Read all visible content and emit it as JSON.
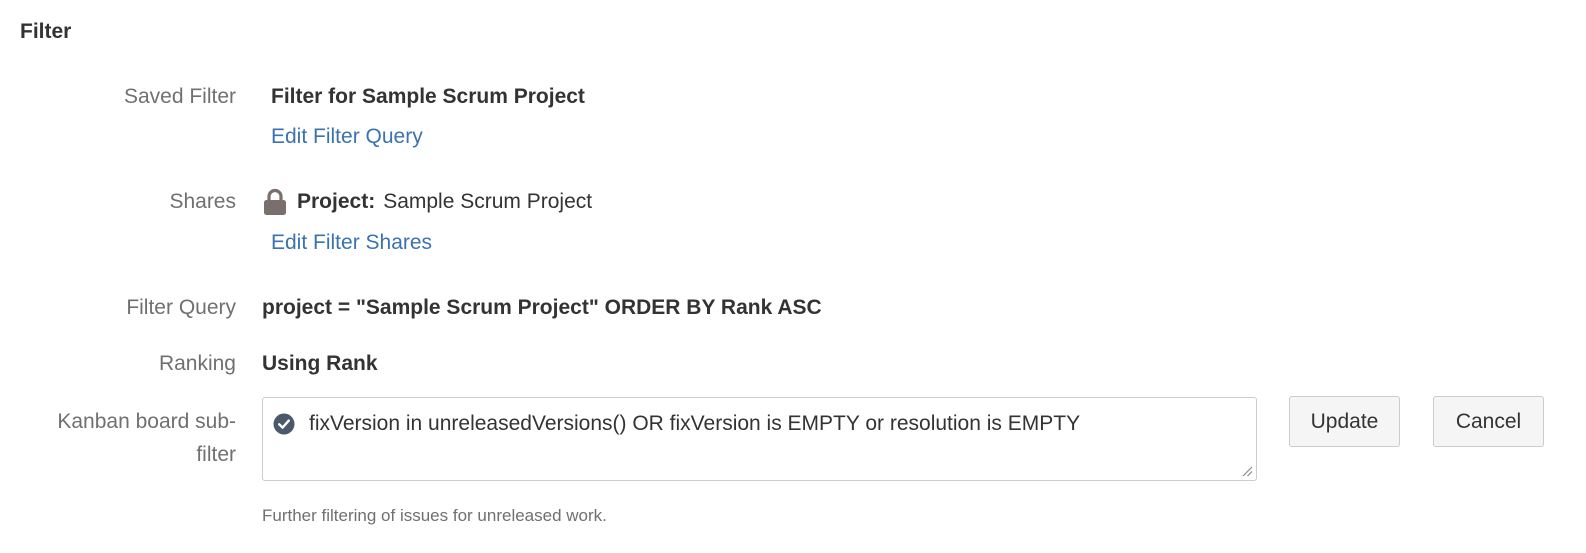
{
  "section": {
    "title": "Filter"
  },
  "saved_filter": {
    "label": "Saved Filter",
    "name": "Filter for Sample Scrum Project",
    "edit_link": "Edit Filter Query"
  },
  "shares": {
    "label": "Shares",
    "icon": "lock-icon",
    "type": "Project:",
    "name": "Sample Scrum Project",
    "edit_link": "Edit Filter Shares"
  },
  "filter_query": {
    "label": "Filter Query",
    "value": "project = \"Sample Scrum Project\" ORDER BY Rank ASC"
  },
  "ranking": {
    "label": "Ranking",
    "value": "Using Rank"
  },
  "subfilter": {
    "label": "Kanban board sub-filter",
    "value": "fixVersion in unreleasedVersions() OR fixVersion is EMPTY or resolution is EMPTY",
    "status_icon": "check-circle-icon",
    "help": "Further filtering of issues for unreleased work.",
    "update_label": "Update",
    "cancel_label": "Cancel"
  },
  "colors": {
    "link": "#3b73af",
    "label": "#707070",
    "text": "#333333",
    "lock_icon": "#7a6f6c",
    "valid_icon": "#4a5a6a"
  }
}
